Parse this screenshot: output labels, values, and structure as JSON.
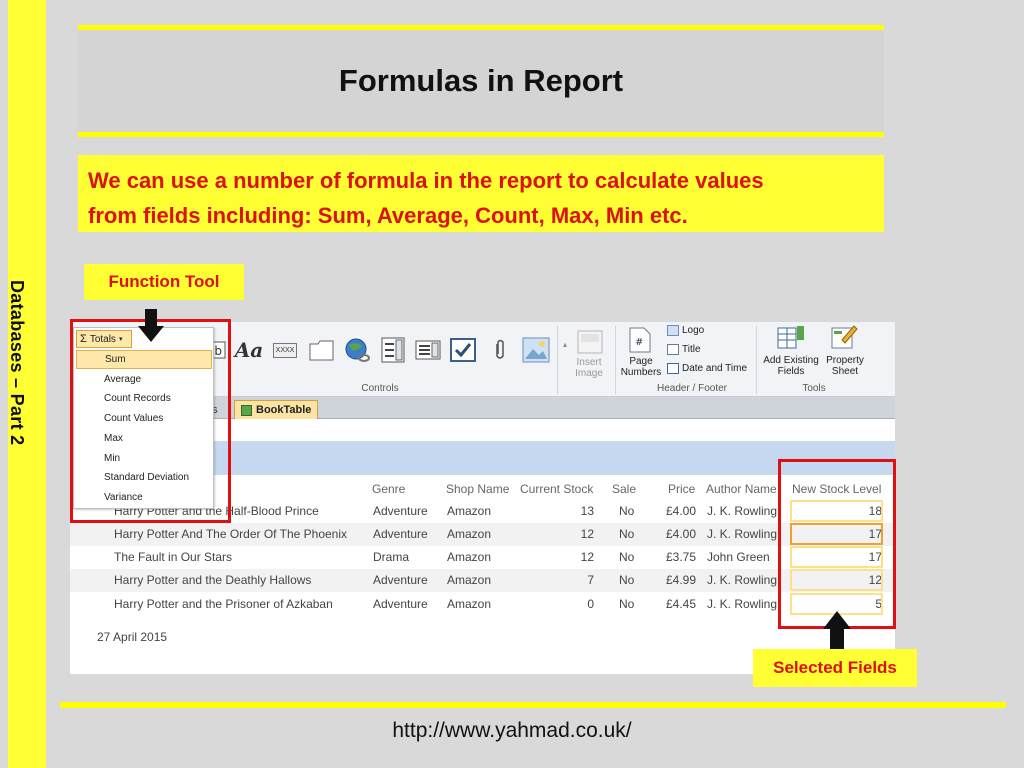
{
  "slide": {
    "title": "Formulas in Report",
    "sidebar_text": "Databases – Part 2",
    "intro_line1": "We can use a number of formula in the report to calculate values",
    "intro_line2": "from fields including: Sum, Average, Count, Max, Min etc.",
    "function_tool_label": "Function Tool",
    "selected_fields_label": "Selected Fields",
    "url": "http://www.yahmad.co.uk/"
  },
  "ribbon": {
    "totals_label": "Totals",
    "aa_label": "Aa",
    "xxxx_label": "XXXX",
    "insert_image_line1": "Insert",
    "insert_image_line2": "Image",
    "page_numbers_line1": "Page",
    "page_numbers_line2": "Numbers",
    "logo_label": "Logo",
    "title_label": "Title",
    "date_time_label": "Date and Time",
    "add_existing_line1": "Add Existing",
    "add_existing_line2": "Fields",
    "property_sheet_line1": "Property",
    "property_sheet_line2": "Sheet",
    "groups": {
      "controls": "Controls",
      "header_footer": "Header / Footer",
      "tools": "Tools"
    }
  },
  "tabs": [
    {
      "label": "ds"
    },
    {
      "label": "BookTable"
    }
  ],
  "totals_menu": [
    {
      "label": "Sum",
      "selected": true
    },
    {
      "label": "Average"
    },
    {
      "label": "Count Records"
    },
    {
      "label": "Count Values"
    },
    {
      "label": "Max"
    },
    {
      "label": "Min"
    },
    {
      "label": "Standard Deviation"
    },
    {
      "label": "Variance"
    }
  ],
  "report": {
    "columns": [
      "Genre",
      "Shop Name",
      "Current Stock",
      "Sale",
      "Price",
      "Author Name",
      "New Stock Level"
    ],
    "rows": [
      {
        "title": "Harry Potter and the Half-Blood Prince",
        "genre": "Adventure",
        "shop": "Amazon",
        "stock": "13",
        "sale": "No",
        "price": "£4.00",
        "author": "J. K. Rowling",
        "new_stock": "18"
      },
      {
        "title": "Harry Potter And The Order Of The Phoenix",
        "genre": "Adventure",
        "shop": "Amazon",
        "stock": "12",
        "sale": "No",
        "price": "£4.00",
        "author": "J. K. Rowling",
        "new_stock": "17"
      },
      {
        "title": "The Fault in Our Stars",
        "genre": "Drama",
        "shop": "Amazon",
        "stock": "12",
        "sale": "No",
        "price": "£3.75",
        "author": "John Green",
        "new_stock": "17"
      },
      {
        "title": "Harry Potter and the Deathly Hallows",
        "genre": "Adventure",
        "shop": "Amazon",
        "stock": "7",
        "sale": "No",
        "price": "£4.99",
        "author": "J. K. Rowling",
        "new_stock": "12"
      },
      {
        "title": "Harry Potter and the Prisoner of Azkaban",
        "genre": "Adventure",
        "shop": "Amazon",
        "stock": "0",
        "sale": "No",
        "price": "£4.45",
        "author": "J. K. Rowling",
        "new_stock": "5"
      }
    ],
    "date": "27 April 2015"
  },
  "colors": {
    "accent_yellow": "#ffff33",
    "highlight_red": "#e01010",
    "band_blue": "#c6d9f1"
  },
  "icons": [
    "sigma-icon",
    "arrow-down-icon",
    "arrow-up-icon",
    "image-icon",
    "checkbox-icon",
    "globe-icon",
    "table-icon"
  ]
}
